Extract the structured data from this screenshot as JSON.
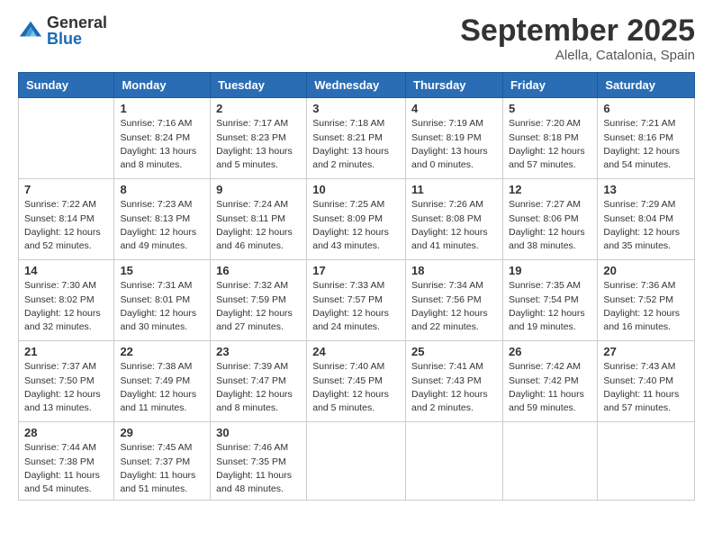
{
  "logo": {
    "general": "General",
    "blue": "Blue"
  },
  "title": {
    "month": "September 2025",
    "location": "Alella, Catalonia, Spain"
  },
  "days_of_week": [
    "Sunday",
    "Monday",
    "Tuesday",
    "Wednesday",
    "Thursday",
    "Friday",
    "Saturday"
  ],
  "weeks": [
    [
      {
        "day": "",
        "info": ""
      },
      {
        "day": "1",
        "info": "Sunrise: 7:16 AM\nSunset: 8:24 PM\nDaylight: 13 hours\nand 8 minutes."
      },
      {
        "day": "2",
        "info": "Sunrise: 7:17 AM\nSunset: 8:23 PM\nDaylight: 13 hours\nand 5 minutes."
      },
      {
        "day": "3",
        "info": "Sunrise: 7:18 AM\nSunset: 8:21 PM\nDaylight: 13 hours\nand 2 minutes."
      },
      {
        "day": "4",
        "info": "Sunrise: 7:19 AM\nSunset: 8:19 PM\nDaylight: 13 hours\nand 0 minutes."
      },
      {
        "day": "5",
        "info": "Sunrise: 7:20 AM\nSunset: 8:18 PM\nDaylight: 12 hours\nand 57 minutes."
      },
      {
        "day": "6",
        "info": "Sunrise: 7:21 AM\nSunset: 8:16 PM\nDaylight: 12 hours\nand 54 minutes."
      }
    ],
    [
      {
        "day": "7",
        "info": "Sunrise: 7:22 AM\nSunset: 8:14 PM\nDaylight: 12 hours\nand 52 minutes."
      },
      {
        "day": "8",
        "info": "Sunrise: 7:23 AM\nSunset: 8:13 PM\nDaylight: 12 hours\nand 49 minutes."
      },
      {
        "day": "9",
        "info": "Sunrise: 7:24 AM\nSunset: 8:11 PM\nDaylight: 12 hours\nand 46 minutes."
      },
      {
        "day": "10",
        "info": "Sunrise: 7:25 AM\nSunset: 8:09 PM\nDaylight: 12 hours\nand 43 minutes."
      },
      {
        "day": "11",
        "info": "Sunrise: 7:26 AM\nSunset: 8:08 PM\nDaylight: 12 hours\nand 41 minutes."
      },
      {
        "day": "12",
        "info": "Sunrise: 7:27 AM\nSunset: 8:06 PM\nDaylight: 12 hours\nand 38 minutes."
      },
      {
        "day": "13",
        "info": "Sunrise: 7:29 AM\nSunset: 8:04 PM\nDaylight: 12 hours\nand 35 minutes."
      }
    ],
    [
      {
        "day": "14",
        "info": "Sunrise: 7:30 AM\nSunset: 8:02 PM\nDaylight: 12 hours\nand 32 minutes."
      },
      {
        "day": "15",
        "info": "Sunrise: 7:31 AM\nSunset: 8:01 PM\nDaylight: 12 hours\nand 30 minutes."
      },
      {
        "day": "16",
        "info": "Sunrise: 7:32 AM\nSunset: 7:59 PM\nDaylight: 12 hours\nand 27 minutes."
      },
      {
        "day": "17",
        "info": "Sunrise: 7:33 AM\nSunset: 7:57 PM\nDaylight: 12 hours\nand 24 minutes."
      },
      {
        "day": "18",
        "info": "Sunrise: 7:34 AM\nSunset: 7:56 PM\nDaylight: 12 hours\nand 22 minutes."
      },
      {
        "day": "19",
        "info": "Sunrise: 7:35 AM\nSunset: 7:54 PM\nDaylight: 12 hours\nand 19 minutes."
      },
      {
        "day": "20",
        "info": "Sunrise: 7:36 AM\nSunset: 7:52 PM\nDaylight: 12 hours\nand 16 minutes."
      }
    ],
    [
      {
        "day": "21",
        "info": "Sunrise: 7:37 AM\nSunset: 7:50 PM\nDaylight: 12 hours\nand 13 minutes."
      },
      {
        "day": "22",
        "info": "Sunrise: 7:38 AM\nSunset: 7:49 PM\nDaylight: 12 hours\nand 11 minutes."
      },
      {
        "day": "23",
        "info": "Sunrise: 7:39 AM\nSunset: 7:47 PM\nDaylight: 12 hours\nand 8 minutes."
      },
      {
        "day": "24",
        "info": "Sunrise: 7:40 AM\nSunset: 7:45 PM\nDaylight: 12 hours\nand 5 minutes."
      },
      {
        "day": "25",
        "info": "Sunrise: 7:41 AM\nSunset: 7:43 PM\nDaylight: 12 hours\nand 2 minutes."
      },
      {
        "day": "26",
        "info": "Sunrise: 7:42 AM\nSunset: 7:42 PM\nDaylight: 11 hours\nand 59 minutes."
      },
      {
        "day": "27",
        "info": "Sunrise: 7:43 AM\nSunset: 7:40 PM\nDaylight: 11 hours\nand 57 minutes."
      }
    ],
    [
      {
        "day": "28",
        "info": "Sunrise: 7:44 AM\nSunset: 7:38 PM\nDaylight: 11 hours\nand 54 minutes."
      },
      {
        "day": "29",
        "info": "Sunrise: 7:45 AM\nSunset: 7:37 PM\nDaylight: 11 hours\nand 51 minutes."
      },
      {
        "day": "30",
        "info": "Sunrise: 7:46 AM\nSunset: 7:35 PM\nDaylight: 11 hours\nand 48 minutes."
      },
      {
        "day": "",
        "info": ""
      },
      {
        "day": "",
        "info": ""
      },
      {
        "day": "",
        "info": ""
      },
      {
        "day": "",
        "info": ""
      }
    ]
  ]
}
